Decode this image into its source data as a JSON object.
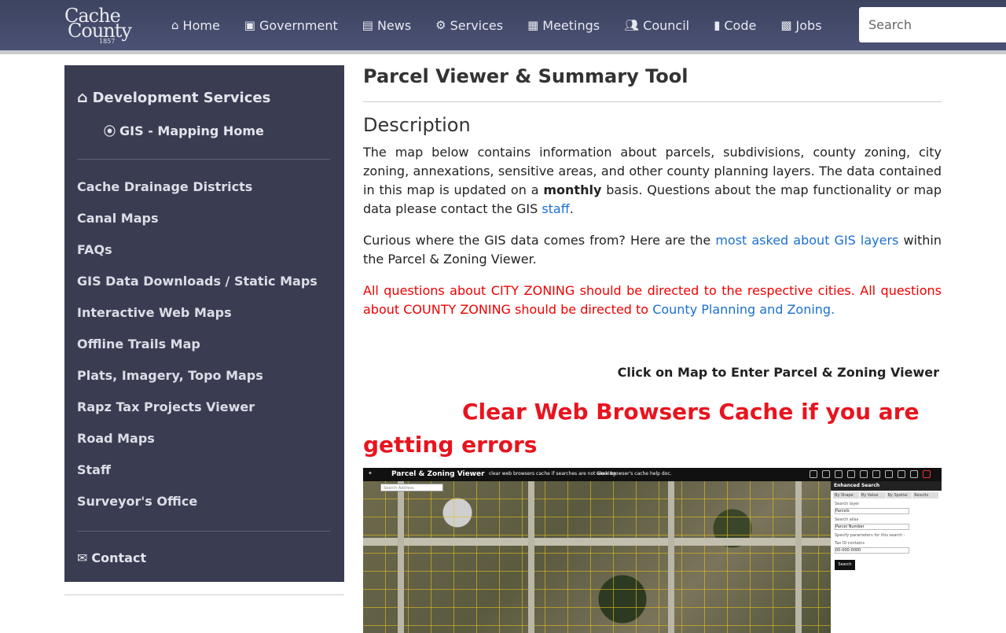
{
  "header": {
    "logo_line1": "Cache",
    "logo_line2": "County",
    "logo_year": "1857",
    "nav": [
      {
        "label": "Home",
        "icon": "home-icon"
      },
      {
        "label": "Government",
        "icon": "contact-book-icon"
      },
      {
        "label": "News",
        "icon": "newspaper-icon"
      },
      {
        "label": "Services",
        "icon": "gear-icon"
      },
      {
        "label": "Meetings",
        "icon": "calendar-icon"
      },
      {
        "label": "Council",
        "icon": "users-icon"
      },
      {
        "label": "Code",
        "icon": "book-icon"
      },
      {
        "label": "Jobs",
        "icon": "briefcase-icon"
      }
    ],
    "search_placeholder": "Search"
  },
  "sidebar": {
    "heading": "Development Services",
    "subheading": "GIS - Mapping Home",
    "items": [
      "Cache Drainage Districts",
      "Canal Maps",
      "FAQs",
      "GIS Data Downloads / Static Maps",
      "Interactive Web Maps",
      "Offline Trails Map",
      "Plats, Imagery, Topo Maps",
      "Rapz Tax Projects Viewer",
      "Road Maps",
      "Staff",
      "Surveyor's Office"
    ],
    "contact": "Contact"
  },
  "main": {
    "title": "Parcel Viewer & Summary Tool",
    "section_heading": "Description",
    "p1_a": "The map below contains information about parcels, subdivisions, county zoning, city zoning, annexations, sensitive areas, and other county planning layers. The data contained in this map is updated on a ",
    "p1_bold": "monthly",
    "p1_b": " basis.  Questions about the map functionality or map data please contact the GIS ",
    "p1_link": "staff",
    "p1_end": ".",
    "p2_a": "Curious where the GIS data comes from? Here are the ",
    "p2_link": "most asked about GIS layers",
    "p2_b": " within the Parcel & Zoning Viewer.",
    "p3_a": "All questions about CITY ZONING should be directed to the respective cities. All questions about COUNTY ZONING should be directed to ",
    "p3_link": "County Planning and Zoning.",
    "click_note": "Click on Map to Enter Parcel & Zoning Viewer",
    "clear_cache_line1": "Clear Web Browsers Cache if you are",
    "clear_cache_line2": "getting errors"
  },
  "map_preview": {
    "title": "Parcel & Zoning Viewer",
    "msg1": "clear web browsers cache if searches are not working",
    "msg2": "Clear browser's cache help doc.",
    "search_placeholder": "Search Address",
    "panel_title": "Enhanced Search",
    "tabs": [
      "By Shape",
      "By Value",
      "By Spatial",
      "Results"
    ],
    "search_layer_label": "Search layer",
    "search_layer_value": "Parcels",
    "search_alias_label": "Search alias",
    "search_alias_value": "Parcel Number",
    "params_label": "Specify parameters for this search :",
    "field_label": "Tax ID contains",
    "field_value": "00-000-0000",
    "search_button": "Search"
  }
}
